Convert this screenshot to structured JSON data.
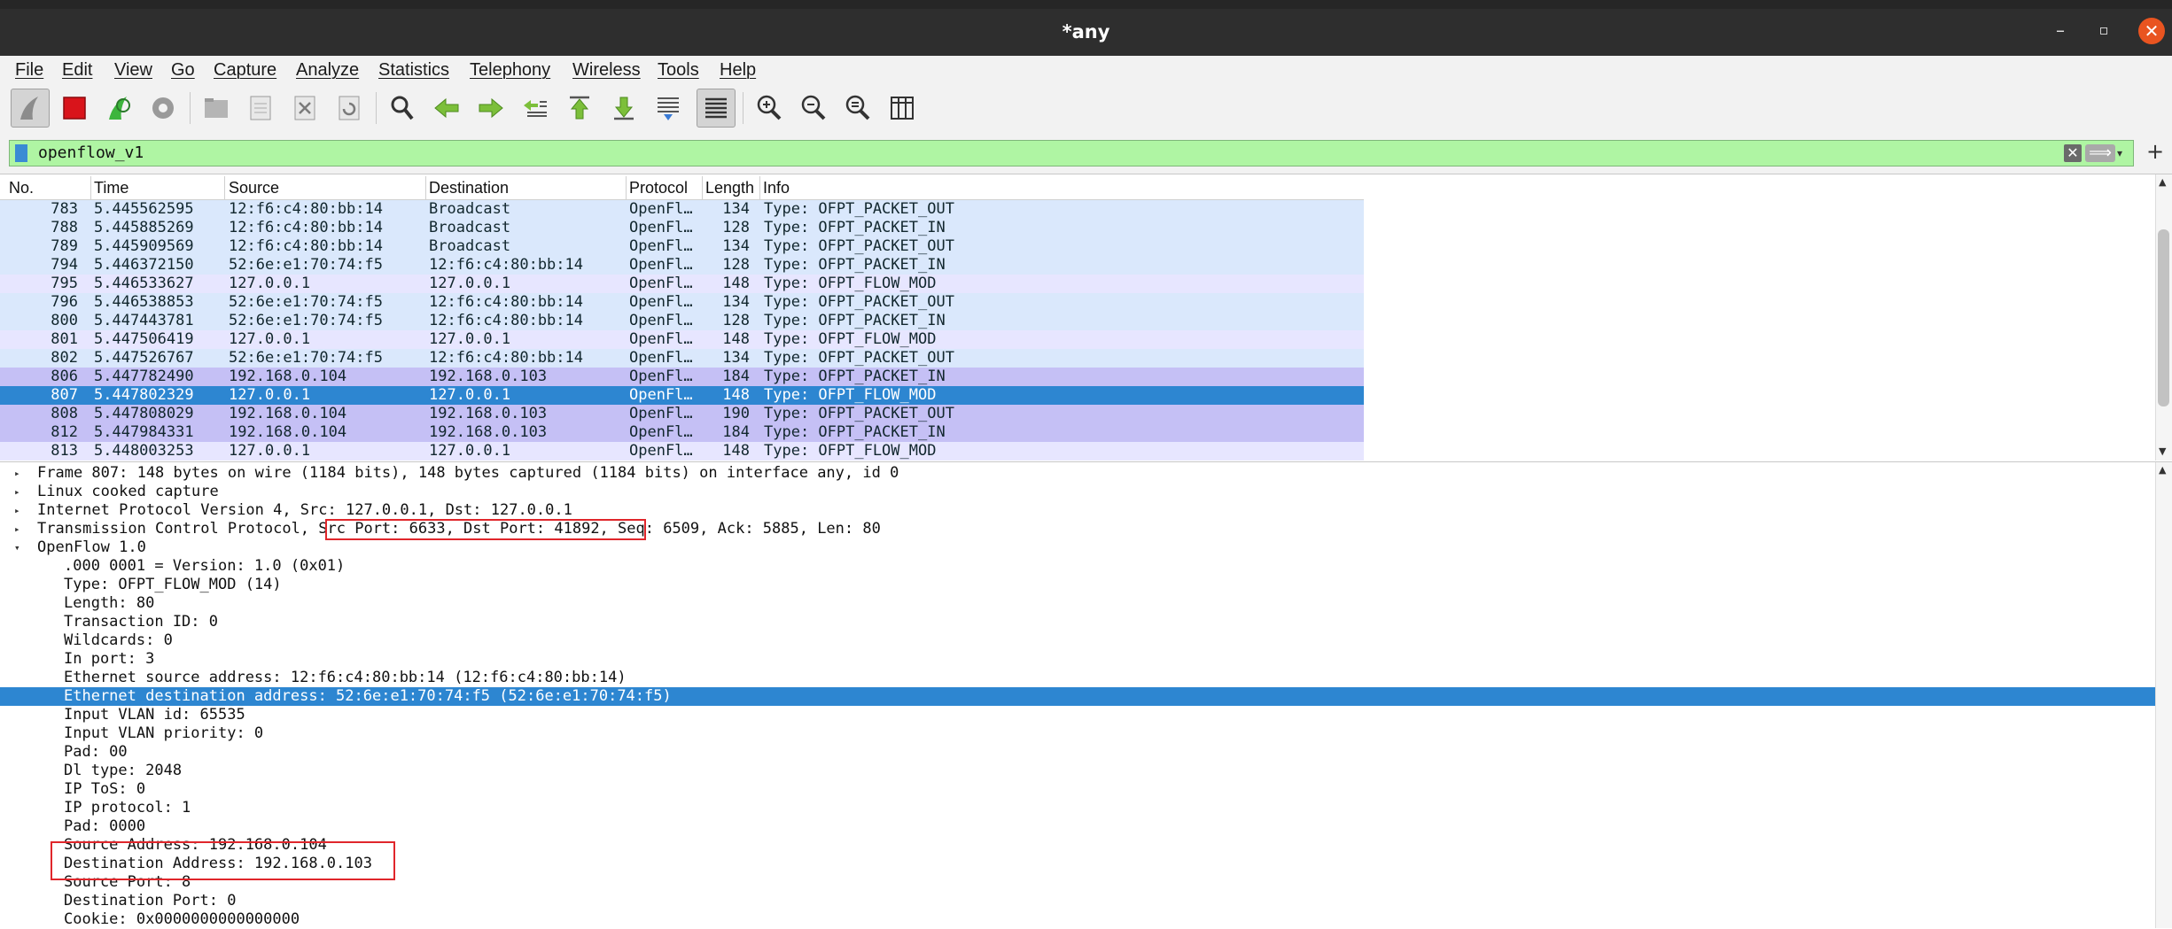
{
  "window": {
    "title": "*any",
    "minimize": "–",
    "maximize": "▫",
    "close": "✕"
  },
  "menu": [
    "File",
    "Edit",
    "View",
    "Go",
    "Capture",
    "Analyze",
    "Statistics",
    "Telephony",
    "Wireless",
    "Tools",
    "Help"
  ],
  "toolbar": {
    "icons": [
      "shark-fin-start-icon",
      "stop-capture-icon",
      "restart-capture-icon",
      "capture-options-icon",
      "open-file-icon",
      "save-file-icon",
      "close-file-icon",
      "reload-file-icon",
      "find-packet-icon",
      "go-back-icon",
      "go-forward-icon",
      "go-to-packet-icon",
      "first-packet-icon",
      "last-packet-icon",
      "auto-scroll-icon",
      "colorize-icon",
      "zoom-in-icon",
      "zoom-out-icon",
      "normal-size-icon",
      "resize-columns-icon"
    ]
  },
  "filter": {
    "value": "openflow_v1",
    "clear": "✕",
    "apply": "⟹",
    "dropdown": "▾",
    "add": "+"
  },
  "packet_list": {
    "columns": [
      "No.",
      "Time",
      "Source",
      "Destination",
      "Protocol",
      "Length",
      "Info"
    ],
    "rows": [
      {
        "no": "783",
        "time": "5.445562595",
        "src": "12:f6:c4:80:bb:14",
        "dst": "Broadcast",
        "proto": "OpenFl…",
        "len": "134",
        "info": "Type: OFPT_PACKET_OUT",
        "bg": "#dae8fc"
      },
      {
        "no": "788",
        "time": "5.445885269",
        "src": "12:f6:c4:80:bb:14",
        "dst": "Broadcast",
        "proto": "OpenFl…",
        "len": "128",
        "info": "Type: OFPT_PACKET_IN",
        "bg": "#dae8fc"
      },
      {
        "no": "789",
        "time": "5.445909569",
        "src": "12:f6:c4:80:bb:14",
        "dst": "Broadcast",
        "proto": "OpenFl…",
        "len": "134",
        "info": "Type: OFPT_PACKET_OUT",
        "bg": "#dae8fc"
      },
      {
        "no": "794",
        "time": "5.446372150",
        "src": "52:6e:e1:70:74:f5",
        "dst": "12:f6:c4:80:bb:14",
        "proto": "OpenFl…",
        "len": "128",
        "info": "Type: OFPT_PACKET_IN",
        "bg": "#dae8fc"
      },
      {
        "no": "795",
        "time": "5.446533627",
        "src": "127.0.0.1",
        "dst": "127.0.0.1",
        "proto": "OpenFl…",
        "len": "148",
        "info": "Type: OFPT_FLOW_MOD",
        "bg": "#e7e6ff"
      },
      {
        "no": "796",
        "time": "5.446538853",
        "src": "52:6e:e1:70:74:f5",
        "dst": "12:f6:c4:80:bb:14",
        "proto": "OpenFl…",
        "len": "134",
        "info": "Type: OFPT_PACKET_OUT",
        "bg": "#dae8fc"
      },
      {
        "no": "800",
        "time": "5.447443781",
        "src": "52:6e:e1:70:74:f5",
        "dst": "12:f6:c4:80:bb:14",
        "proto": "OpenFl…",
        "len": "128",
        "info": "Type: OFPT_PACKET_IN",
        "bg": "#dae8fc"
      },
      {
        "no": "801",
        "time": "5.447506419",
        "src": "127.0.0.1",
        "dst": "127.0.0.1",
        "proto": "OpenFl…",
        "len": "148",
        "info": "Type: OFPT_FLOW_MOD",
        "bg": "#e7e6ff"
      },
      {
        "no": "802",
        "time": "5.447526767",
        "src": "52:6e:e1:70:74:f5",
        "dst": "12:f6:c4:80:bb:14",
        "proto": "OpenFl…",
        "len": "134",
        "info": "Type: OFPT_PACKET_OUT",
        "bg": "#dae8fc"
      },
      {
        "no": "806",
        "time": "5.447782490",
        "src": "192.168.0.104",
        "dst": "192.168.0.103",
        "proto": "OpenFl…",
        "len": "184",
        "info": "Type: OFPT_PACKET_IN",
        "bg": "#c5c0f5"
      },
      {
        "no": "807",
        "time": "5.447802329",
        "src": "127.0.0.1",
        "dst": "127.0.0.1",
        "proto": "OpenFl…",
        "len": "148",
        "info": "Type: OFPT_FLOW_MOD",
        "bg": "#2d86d1",
        "selected": true
      },
      {
        "no": "808",
        "time": "5.447808029",
        "src": "192.168.0.104",
        "dst": "192.168.0.103",
        "proto": "OpenFl…",
        "len": "190",
        "info": "Type: OFPT_PACKET_OUT",
        "bg": "#c5c0f5"
      },
      {
        "no": "812",
        "time": "5.447984331",
        "src": "192.168.0.104",
        "dst": "192.168.0.103",
        "proto": "OpenFl…",
        "len": "184",
        "info": "Type: OFPT_PACKET_IN",
        "bg": "#c5c0f5"
      },
      {
        "no": "813",
        "time": "5.448003253",
        "src": "127.0.0.1",
        "dst": "127.0.0.1",
        "proto": "OpenFl…",
        "len": "148",
        "info": "Type: OFPT_FLOW_MOD",
        "bg": "#e7e6ff"
      }
    ]
  },
  "details": {
    "rows": [
      {
        "text": "Frame 807: 148 bytes on wire (1184 bits), 148 bytes captured (1184 bits) on interface any, id 0",
        "indent": 0,
        "tri": "▸"
      },
      {
        "text": "Linux cooked capture",
        "indent": 0,
        "tri": "▸"
      },
      {
        "text": "Internet Protocol Version 4, Src: 127.0.0.1, Dst: 127.0.0.1",
        "indent": 0,
        "tri": "▸"
      },
      {
        "text": "Transmission Control Protocol, Src Port: 6633, Dst Port: 41892, Seq: 6509, Ack: 5885, Len: 80",
        "indent": 0,
        "tri": "▸"
      },
      {
        "text": "OpenFlow 1.0",
        "indent": 0,
        "tri": "▾"
      },
      {
        "text": ".000 0001 = Version: 1.0 (0x01)",
        "indent": 1
      },
      {
        "text": "Type: OFPT_FLOW_MOD (14)",
        "indent": 1
      },
      {
        "text": "Length: 80",
        "indent": 1
      },
      {
        "text": "Transaction ID: 0",
        "indent": 1
      },
      {
        "text": "Wildcards: 0",
        "indent": 1
      },
      {
        "text": "In port: 3",
        "indent": 1
      },
      {
        "text": "Ethernet source address: 12:f6:c4:80:bb:14 (12:f6:c4:80:bb:14)",
        "indent": 1
      },
      {
        "text": "Ethernet destination address: 52:6e:e1:70:74:f5 (52:6e:e1:70:74:f5)",
        "indent": 1,
        "selected": true
      },
      {
        "text": "Input VLAN id: 65535",
        "indent": 1
      },
      {
        "text": "Input VLAN priority: 0",
        "indent": 1
      },
      {
        "text": "Pad: 00",
        "indent": 1
      },
      {
        "text": "Dl type: 2048",
        "indent": 1
      },
      {
        "text": "IP ToS: 0",
        "indent": 1
      },
      {
        "text": "IP protocol: 1",
        "indent": 1
      },
      {
        "text": "Pad: 0000",
        "indent": 1
      },
      {
        "text": "Source Address: 192.168.0.104",
        "indent": 1
      },
      {
        "text": "Destination Address: 192.168.0.103",
        "indent": 1
      },
      {
        "text": "Source Port: 8",
        "indent": 1
      },
      {
        "text": "Destination Port: 0",
        "indent": 1
      },
      {
        "text": "Cookie: 0x0000000000000000",
        "indent": 1
      }
    ]
  },
  "colors": {
    "selection": "#2d86d1",
    "highlight_box": "#e0262b",
    "filter_ok": "#aff5a3"
  }
}
